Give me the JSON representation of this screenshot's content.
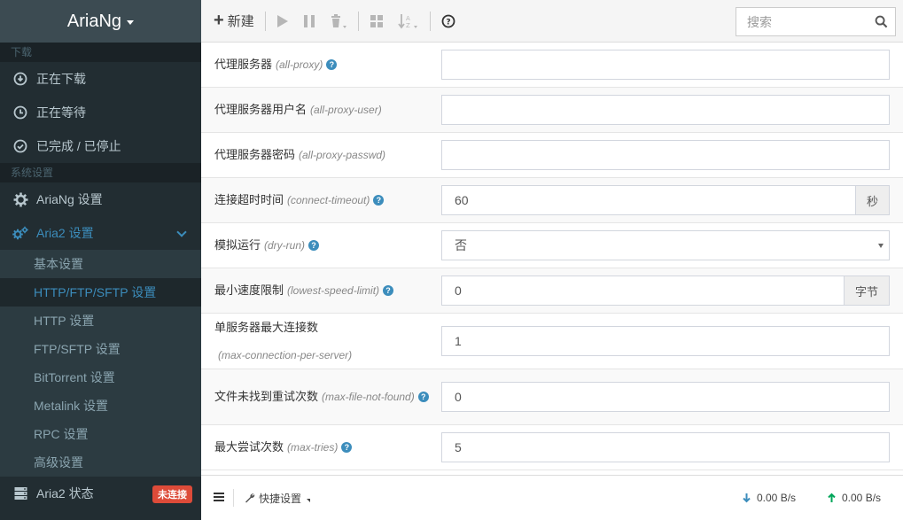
{
  "app": {
    "brand": "AriaNg"
  },
  "sidebar": {
    "section_download": "下载",
    "downloading": "正在下载",
    "waiting": "正在等待",
    "stopped": "已完成 / 已停止",
    "section_settings": "系统设置",
    "ariang_settings": "AriaNg 设置",
    "aria2_settings": "Aria2 设置",
    "sub_items": [
      "基本设置",
      "HTTP/FTP/SFTP 设置",
      "HTTP 设置",
      "FTP/SFTP 设置",
      "BitTorrent 设置",
      "Metalink 设置",
      "RPC 设置",
      "高级设置"
    ],
    "active_sub": "HTTP/FTP/SFTP 设置",
    "aria2_status": "Aria2 状态",
    "status_badge": "未连接"
  },
  "toolbar": {
    "new_label": "新建",
    "search_placeholder": "搜索"
  },
  "settings": [
    {
      "label": "代理服务器",
      "option": "(all-proxy)",
      "help": true,
      "value": "",
      "addon": ""
    },
    {
      "label": "代理服务器用户名",
      "option": "(all-proxy-user)",
      "help": false,
      "value": "",
      "addon": ""
    },
    {
      "label": "代理服务器密码",
      "option": "(all-proxy-passwd)",
      "help": false,
      "value": "",
      "addon": ""
    },
    {
      "label": "连接超时时间",
      "option": "(connect-timeout)",
      "help": true,
      "value": "60",
      "addon": "秒"
    },
    {
      "label": "模拟运行",
      "option": "(dry-run)",
      "help": true,
      "value": "否",
      "addon": "",
      "select": true
    },
    {
      "label": "最小速度限制",
      "option": "(lowest-speed-limit)",
      "help": true,
      "value": "0",
      "addon": "字节"
    },
    {
      "label": "单服务器最大连接数",
      "option": "(max-connection-per-server)",
      "help": false,
      "value": "1",
      "addon": ""
    },
    {
      "label": "文件未找到重试次数",
      "option": "(max-file-not-found)",
      "help": true,
      "value": "0",
      "addon": ""
    },
    {
      "label": "最大尝试次数",
      "option": "(max-tries)",
      "help": true,
      "value": "5",
      "addon": ""
    }
  ],
  "footer": {
    "quick_settings": "快捷设置",
    "download_speed": "0.00 B/s",
    "upload_speed": "0.00 B/s"
  },
  "colors": {
    "accent": "#3c8dbc",
    "badge": "#dd4b39",
    "sidebar_bg": "#222d32",
    "download_arrow": "#3c8dbc",
    "upload_arrow": "#00a65a"
  }
}
